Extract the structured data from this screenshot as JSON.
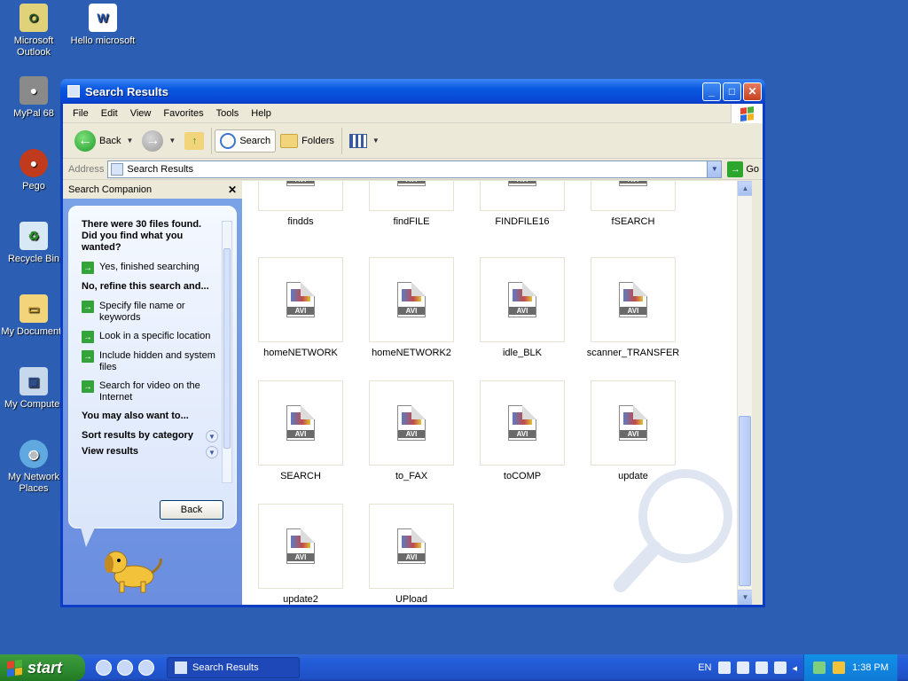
{
  "desktop": {
    "icons": [
      {
        "label": "Microsoft Outlook"
      },
      {
        "label": "Hello microsoft"
      },
      {
        "label": "MyPal 68"
      },
      {
        "label": "Pego"
      },
      {
        "label": "Recycle Bin"
      },
      {
        "label": "My Documents"
      },
      {
        "label": "My Computer"
      },
      {
        "label": "My Network Places"
      }
    ]
  },
  "window": {
    "title": "Search Results",
    "menu": [
      "File",
      "Edit",
      "View",
      "Favorites",
      "Tools",
      "Help"
    ],
    "toolbar": {
      "back": "Back",
      "search": "Search",
      "folders": "Folders"
    },
    "address": {
      "label": "Address",
      "value": "Search Results",
      "go": "Go"
    }
  },
  "companion": {
    "title": "Search Companion",
    "found_text": "There were 30 files found. Did you find what you wanted?",
    "yes_link": "Yes, finished searching",
    "refine_heading": "No, refine this search and...",
    "refine_links": [
      "Specify file name or keywords",
      "Look in a specific location",
      "Include hidden and system files",
      "Search for video on the Internet"
    ],
    "also_heading": "You may also want to...",
    "sort_label": "Sort results by category",
    "view_label": "View results",
    "back_button": "Back"
  },
  "files": [
    {
      "name": "findds"
    },
    {
      "name": "findFILE"
    },
    {
      "name": "FINDFILE16"
    },
    {
      "name": "fSEARCH"
    },
    {
      "name": "homeNETWORK"
    },
    {
      "name": "homeNETWORK2"
    },
    {
      "name": "idle_BLK"
    },
    {
      "name": "scanner_TRANSFER"
    },
    {
      "name": "SEARCH"
    },
    {
      "name": "to_FAX"
    },
    {
      "name": "toCOMP"
    },
    {
      "name": "update"
    },
    {
      "name": "update2"
    },
    {
      "name": "UPload"
    }
  ],
  "file_badge": "AVI",
  "taskbar": {
    "start": "start",
    "task": "Search Results",
    "lang": "EN",
    "time": "1:38 PM"
  }
}
